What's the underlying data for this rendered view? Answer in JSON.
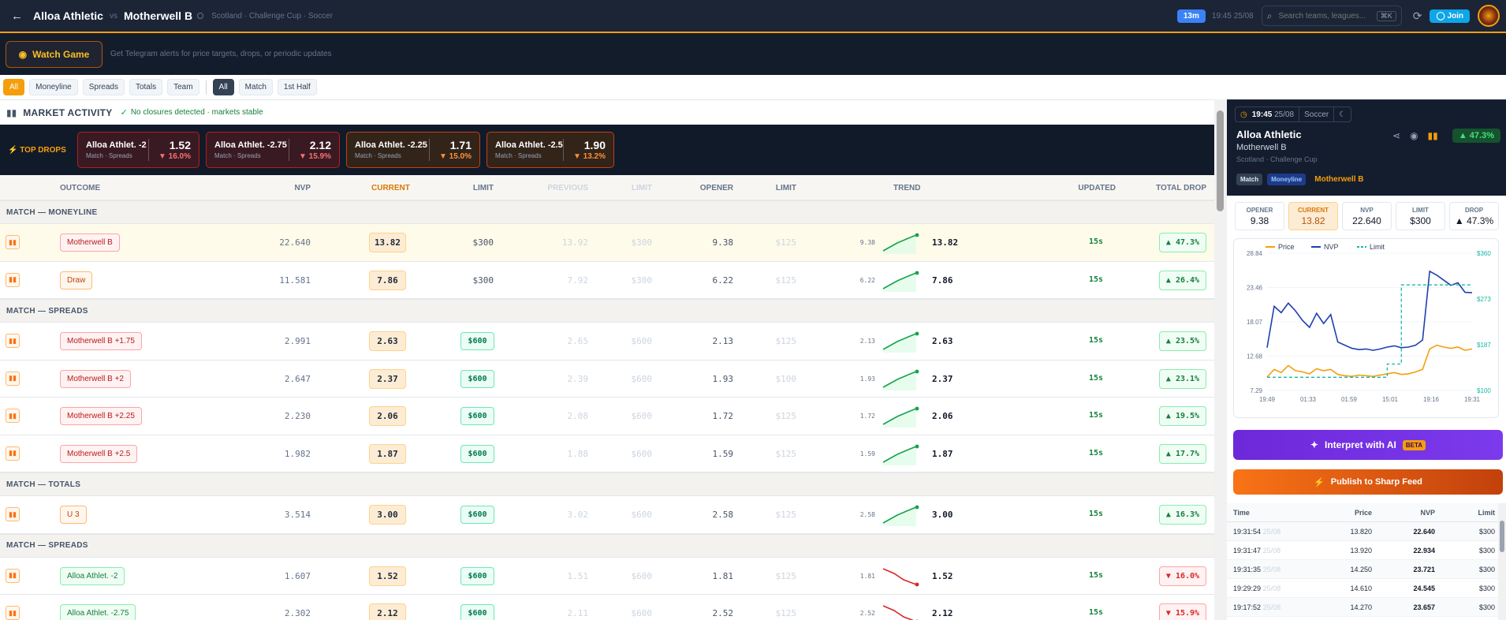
{
  "header": {
    "team1": "Alloa Athletic",
    "vs": "vs",
    "team2": "Motherwell B",
    "meta": "Scotland · Challenge Cup · Soccer",
    "time_badge": "13m",
    "time": "19:45 25/08",
    "search_placeholder": "Search teams, leagues...",
    "search_kbd": "⌘K",
    "join": "Join"
  },
  "watch": {
    "button": "Watch Game",
    "text": "Get Telegram alerts for price targets, drops, or periodic updates"
  },
  "filters": {
    "group1": [
      "All",
      "Moneyline",
      "Spreads",
      "Totals",
      "Team"
    ],
    "group2": [
      "All",
      "Match",
      "1st Half"
    ]
  },
  "activity": {
    "title": "MARKET ACTIVITY",
    "status": "No closures detected · markets stable"
  },
  "top_drops": {
    "label": "TOP DROPS",
    "items": [
      {
        "name": "Alloa Athlet. -2",
        "sub": "Match · Spreads",
        "price": "1.52",
        "pct": "▼ 16.0%",
        "style": "red"
      },
      {
        "name": "Alloa Athlet. -2.75",
        "sub": "Match · Spreads",
        "price": "2.12",
        "pct": "▼ 15.9%",
        "style": "red"
      },
      {
        "name": "Alloa Athlet. -2.25",
        "sub": "Match · Spreads",
        "price": "1.71",
        "pct": "▼ 15.0%",
        "style": "orange"
      },
      {
        "name": "Alloa Athlet. -2.5",
        "sub": "Match · Spreads",
        "price": "1.90",
        "pct": "▼ 13.2%",
        "style": "orange"
      }
    ]
  },
  "table": {
    "headers": [
      "OUTCOME",
      "NVP",
      "CURRENT",
      "LIMIT",
      "PREVIOUS",
      "LIMIT",
      "OPENER",
      "LIMIT",
      "TREND",
      "UPDATED",
      "TOTAL DROP"
    ],
    "sections": [
      {
        "title": "MATCH — MONEYLINE",
        "rows": [
          {
            "outcome": "Motherwell B",
            "color": "red",
            "nvp": "22.640",
            "current": "13.82",
            "limit": "$300",
            "limit_green": false,
            "previous": "13.92",
            "limit2": "$300",
            "opener": "9.38",
            "limit3": "$125",
            "trend_from": "9.38",
            "trend_to": "13.82",
            "trend_dir": "up",
            "updated": "15s",
            "drop": "▲ 47.3%",
            "drop_dir": "up",
            "highlight": true
          },
          {
            "outcome": "Draw",
            "color": "orange",
            "nvp": "11.581",
            "current": "7.86",
            "limit": "$300",
            "limit_green": false,
            "previous": "7.92",
            "limit2": "$300",
            "opener": "6.22",
            "limit3": "$125",
            "trend_from": "6.22",
            "trend_to": "7.86",
            "trend_dir": "up",
            "updated": "15s",
            "drop": "▲ 26.4%",
            "drop_dir": "up",
            "highlight": false
          }
        ]
      },
      {
        "title": "MATCH — SPREADS",
        "rows": [
          {
            "outcome": "Motherwell B +1.75",
            "color": "red",
            "nvp": "2.991",
            "current": "2.63",
            "limit": "$600",
            "limit_green": true,
            "previous": "2.65",
            "limit2": "$600",
            "opener": "2.13",
            "limit3": "$125",
            "trend_from": "2.13",
            "trend_to": "2.63",
            "trend_dir": "up",
            "updated": "15s",
            "drop": "▲ 23.5%",
            "drop_dir": "up",
            "highlight": false
          },
          {
            "outcome": "Motherwell B +2",
            "color": "red",
            "nvp": "2.647",
            "current": "2.37",
            "limit": "$600",
            "limit_green": true,
            "previous": "2.39",
            "limit2": "$600",
            "opener": "1.93",
            "limit3": "$100",
            "trend_from": "1.93",
            "trend_to": "2.37",
            "trend_dir": "up",
            "updated": "15s",
            "drop": "▲ 23.1%",
            "drop_dir": "up",
            "highlight": false
          },
          {
            "outcome": "Motherwell B +2.25",
            "color": "red",
            "nvp": "2.230",
            "current": "2.06",
            "limit": "$600",
            "limit_green": true,
            "previous": "2.08",
            "limit2": "$600",
            "opener": "1.72",
            "limit3": "$125",
            "trend_from": "1.72",
            "trend_to": "2.06",
            "trend_dir": "up",
            "updated": "15s",
            "drop": "▲ 19.5%",
            "drop_dir": "up",
            "highlight": false
          },
          {
            "outcome": "Motherwell B +2.5",
            "color": "red",
            "nvp": "1.982",
            "current": "1.87",
            "limit": "$600",
            "limit_green": true,
            "previous": "1.88",
            "limit2": "$600",
            "opener": "1.59",
            "limit3": "$125",
            "trend_from": "1.59",
            "trend_to": "1.87",
            "trend_dir": "up",
            "updated": "15s",
            "drop": "▲ 17.7%",
            "drop_dir": "up",
            "highlight": false
          }
        ]
      },
      {
        "title": "MATCH — TOTALS",
        "rows": [
          {
            "outcome": "U 3",
            "color": "orange",
            "nvp": "3.514",
            "current": "3.00",
            "limit": "$600",
            "limit_green": true,
            "previous": "3.02",
            "limit2": "$600",
            "opener": "2.58",
            "limit3": "$125",
            "trend_from": "2.58",
            "trend_to": "3.00",
            "trend_dir": "up",
            "updated": "15s",
            "drop": "▲ 16.3%",
            "drop_dir": "up",
            "highlight": false
          }
        ]
      },
      {
        "title": "MATCH — SPREADS",
        "rows": [
          {
            "outcome": "Alloa Athlet. -2",
            "color": "green",
            "nvp": "1.607",
            "current": "1.52",
            "limit": "$600",
            "limit_green": true,
            "previous": "1.51",
            "limit2": "$600",
            "opener": "1.81",
            "limit3": "$125",
            "trend_from": "1.81",
            "trend_to": "1.52",
            "trend_dir": "down",
            "updated": "15s",
            "drop": "▼ 16.0%",
            "drop_dir": "down",
            "highlight": false
          },
          {
            "outcome": "Alloa Athlet. -2.75",
            "color": "green",
            "nvp": "2.302",
            "current": "2.12",
            "limit": "$600",
            "limit_green": true,
            "previous": "2.11",
            "limit2": "$600",
            "opener": "2.52",
            "limit3": "$125",
            "trend_from": "2.52",
            "trend_to": "2.12",
            "trend_dir": "down",
            "updated": "15s",
            "drop": "▼ 15.9%",
            "drop_dir": "down",
            "highlight": false
          }
        ]
      }
    ]
  },
  "panel": {
    "time": "19:45",
    "date": "25/08",
    "sport": "Soccer",
    "team1": "Alloa Athletic",
    "team2": "Motherwell B",
    "league": "Scotland · Challenge Cup",
    "pct": "▲ 47.3%",
    "tags": [
      "Match",
      "Moneyline"
    ],
    "selected": "Motherwell B",
    "stats": [
      {
        "label": "OPENER",
        "value": "9.38"
      },
      {
        "label": "CURRENT",
        "value": "13.82"
      },
      {
        "label": "NVP",
        "value": "22.640"
      },
      {
        "label": "LIMIT",
        "value": "$300"
      },
      {
        "label": "DROP",
        "value": "▲ 47.3%"
      }
    ],
    "ai_button": "Interpret with AI",
    "ai_badge": "BETA",
    "publish_button": "Publish to Sharp Feed",
    "history_headers": [
      "Time",
      "Price",
      "NVP",
      "Limit"
    ],
    "history": [
      {
        "time": "19:31:54",
        "date": "25/08",
        "price": "13.820",
        "nvp": "22.640",
        "limit": "$300"
      },
      {
        "time": "19:31:47",
        "date": "25/08",
        "price": "13.920",
        "nvp": "22.934",
        "limit": "$300"
      },
      {
        "time": "19:31:35",
        "date": "25/08",
        "price": "14.250",
        "nvp": "23.721",
        "limit": "$300"
      },
      {
        "time": "19:29:29",
        "date": "25/08",
        "price": "14.610",
        "nvp": "24.545",
        "limit": "$300"
      },
      {
        "time": "19:17:52",
        "date": "25/08",
        "price": "14.270",
        "nvp": "23.657",
        "limit": "$300"
      }
    ]
  },
  "chart_data": {
    "type": "line",
    "legend": [
      "Price",
      "NVP",
      "Limit"
    ],
    "legend_placement": "top-left",
    "x_ticks": [
      "19:49",
      "01:33",
      "01:59",
      "15:01",
      "19:16",
      "19:31"
    ],
    "y_left_ticks": [
      "28.84",
      "23.46",
      "18.07",
      "12.68",
      "7.29"
    ],
    "y_right_ticks": [
      "$360",
      "$273",
      "$187",
      "$100"
    ],
    "ylim": [
      7.29,
      28.84
    ],
    "series": [
      {
        "name": "Price",
        "color": "#f59e0b",
        "values": [
          9.4,
          10.6,
          10.1,
          11.2,
          10.4,
          10.2,
          9.9,
          10.7,
          10.4,
          10.6,
          9.8,
          9.6,
          9.5,
          9.7,
          9.6,
          9.5,
          9.7,
          9.9,
          10.1,
          9.8,
          9.9,
          10.2,
          10.6,
          13.8,
          14.4,
          14.1,
          13.9,
          14.1,
          13.6,
          13.8
        ]
      },
      {
        "name": "NVP",
        "color": "#1e40af",
        "values": [
          14.0,
          20.5,
          19.5,
          21.0,
          19.8,
          18.3,
          17.2,
          19.4,
          17.8,
          19.2,
          14.9,
          14.4,
          13.9,
          13.7,
          13.8,
          13.6,
          13.8,
          14.1,
          14.3,
          14.0,
          14.1,
          14.4,
          15.2,
          26.0,
          25.4,
          24.6,
          23.8,
          24.2,
          22.7,
          22.64
        ]
      },
      {
        "name": "Limit",
        "color": "#14b8a6",
        "dashed": true,
        "values": [
          125,
          125,
          125,
          125,
          125,
          125,
          125,
          125,
          125,
          125,
          125,
          125,
          125,
          125,
          125,
          125,
          125,
          150,
          150,
          300,
          300,
          300,
          300,
          300,
          300,
          300,
          300,
          300,
          300,
          300
        ]
      }
    ],
    "right_axis_range": [
      100,
      360
    ]
  }
}
